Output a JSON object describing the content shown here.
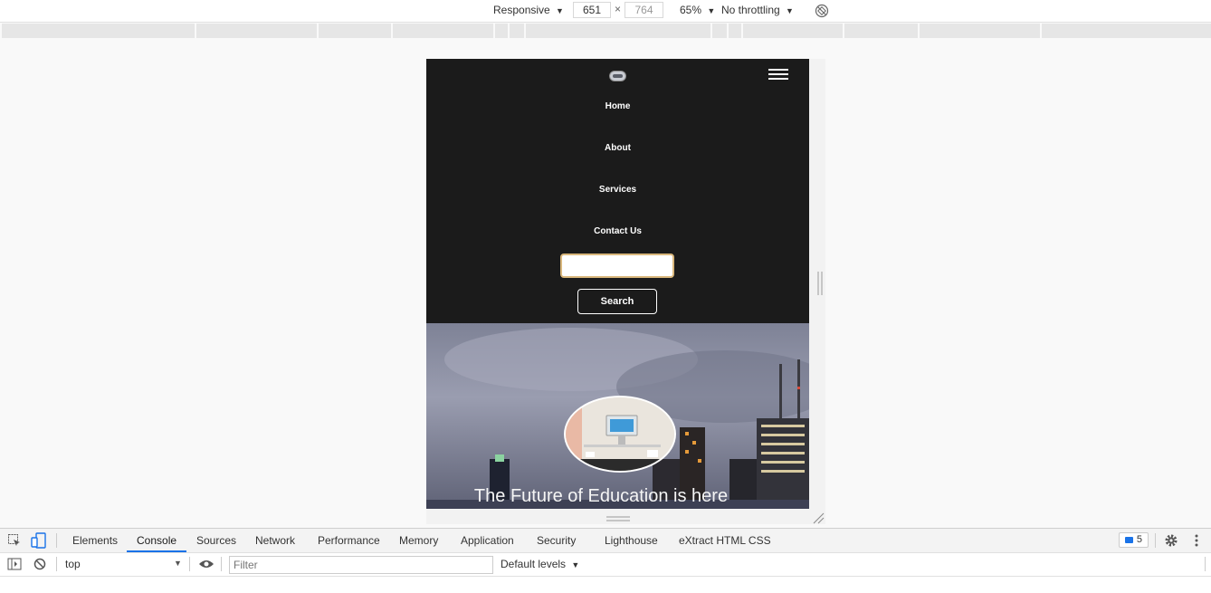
{
  "device_toolbar": {
    "mode": "Responsive",
    "width": "651",
    "height": "764",
    "zoom": "65%",
    "throttling": "No throttling",
    "dropdown_glyph": "▼",
    "times_glyph": "×"
  },
  "site": {
    "nav": [
      "Home",
      "About",
      "Services",
      "Contact Us"
    ],
    "search_button": "Search",
    "hero_title": "The Future of Education is here"
  },
  "devtools": {
    "tabs": [
      "Elements",
      "Console",
      "Sources",
      "Network",
      "Performance",
      "Memory",
      "Application",
      "Security",
      "Lighthouse",
      "eXtract HTML CSS"
    ],
    "active_tab": "Console",
    "issues_count": "5",
    "context": "top",
    "filter_placeholder": "Filter",
    "levels": "Default levels"
  },
  "colors": {
    "nav_bg": "#1b1b1b",
    "accent": "#1a73e8",
    "search_border": "#d9b77c"
  }
}
